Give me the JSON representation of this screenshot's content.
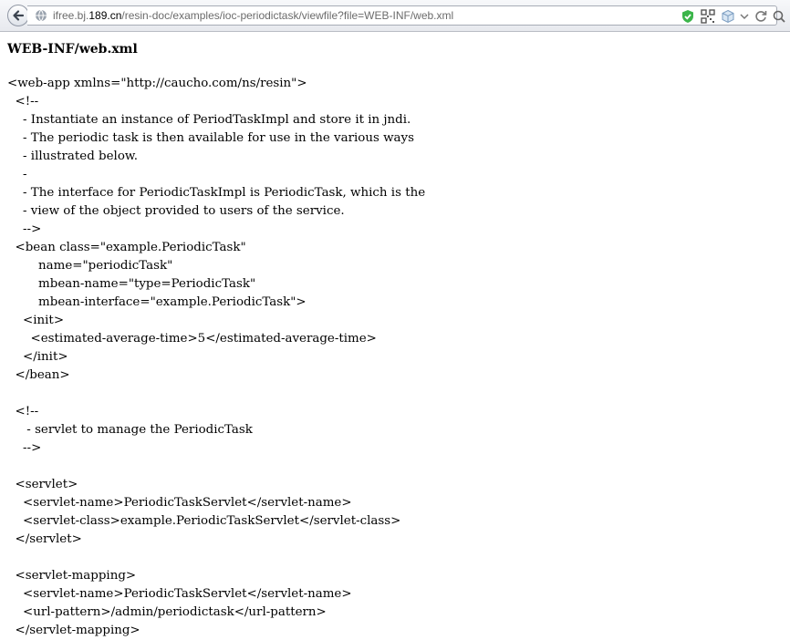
{
  "browser": {
    "url_prefix": "ifree.bj.",
    "url_domain": "189.cn",
    "url_suffix": "/resin-doc/examples/ioc-periodictask/viewfile?file=WEB-INF/web.xml",
    "icons": [
      "back-arrow-icon",
      "site-globe-icon",
      "shield-check-icon",
      "qr-code-icon",
      "box-icon",
      "dropdown-arrow-icon",
      "reload-icon",
      "search-icon"
    ]
  },
  "page": {
    "title": "WEB-INF/web.xml",
    "lines": [
      "<web-app xmlns=\"http://caucho.com/ns/resin\">",
      "  <!--",
      "    - Instantiate an instance of PeriodTaskImpl and store it in jndi.",
      "    - The periodic task is then available for use in the various ways",
      "    - illustrated below.",
      "    -",
      "    - The interface for PeriodicTaskImpl is PeriodicTask, which is the",
      "    - view of the object provided to users of the service.",
      "    -->",
      "  <bean class=\"example.PeriodicTask\"",
      "        name=\"periodicTask\"",
      "        mbean-name=\"type=PeriodicTask\"",
      "        mbean-interface=\"example.PeriodicTask\">",
      "    <init>",
      "      <estimated-average-time>5</estimated-average-time>",
      "    </init>",
      "  </bean>",
      "",
      "  <!--",
      "     - servlet to manage the PeriodicTask",
      "    -->",
      "",
      "  <servlet>",
      "    <servlet-name>PeriodicTaskServlet</servlet-name>",
      "    <servlet-class>example.PeriodicTaskServlet</servlet-class>",
      "  </servlet>",
      "",
      "  <servlet-mapping>",
      "    <servlet-name>PeriodicTaskServlet</servlet-name>",
      "    <url-pattern>/admin/periodictask</url-pattern>",
      "  </servlet-mapping>"
    ]
  }
}
